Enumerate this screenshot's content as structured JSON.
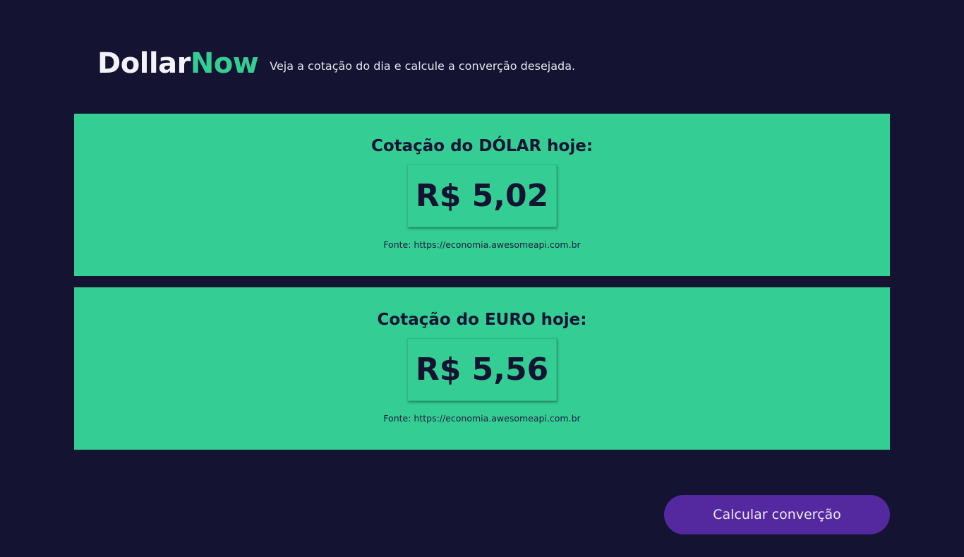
{
  "header": {
    "logo_part1": "Dollar",
    "logo_part2": "Now",
    "tagline": "Veja a cotação do dia e calcule a converção desejada."
  },
  "colors": {
    "background": "#141331",
    "accent_green": "#34cd94",
    "button_purple": "#5429a0"
  },
  "quotes": [
    {
      "title": "Cotação do DÓLAR hoje:",
      "value": "R$ 5,02",
      "source": "Fonte: https://economia.awesomeapi.com.br"
    },
    {
      "title": "Cotação do EURO hoje:",
      "value": "R$ 5,56",
      "source": "Fonte: https://economia.awesomeapi.com.br"
    }
  ],
  "actions": {
    "calculate_label": "Calcular converção"
  }
}
